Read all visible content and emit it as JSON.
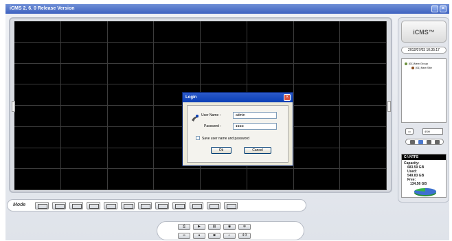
{
  "window": {
    "title": "iCMS 2. 6. 0 Release Version",
    "min_label": "_",
    "close_label": "×"
  },
  "login": {
    "title": "Login",
    "username_label": "User Name :",
    "username_value": "admin",
    "password_label": "Password :",
    "password_value": "●●●●",
    "save_label": "Save user name and password",
    "ok_label": "Ok",
    "cancel_label": "Cancel"
  },
  "sidebar": {
    "logo": "iCMS™",
    "datetime": "2012/07/03 10:35:17",
    "tree": [
      {
        "label": "[01] New Group"
      },
      {
        "label": "[01] New Site"
      }
    ],
    "split_mode": "4SH"
  },
  "disk": {
    "label": "C:\\ NTFS",
    "capacity_label": "Capacity:",
    "capacity_value": "683.59 GB",
    "used_label": "Used:",
    "used_value": "549.83 GB",
    "free_label": "Free:",
    "free_value": "134.56 GB",
    "used_fraction": 0.804,
    "colors": {
      "used": "#3d6fd1",
      "free": "#35b44a"
    }
  },
  "mode": {
    "label": "Mode"
  },
  "controls": {
    "ratio_label": "4:3"
  }
}
